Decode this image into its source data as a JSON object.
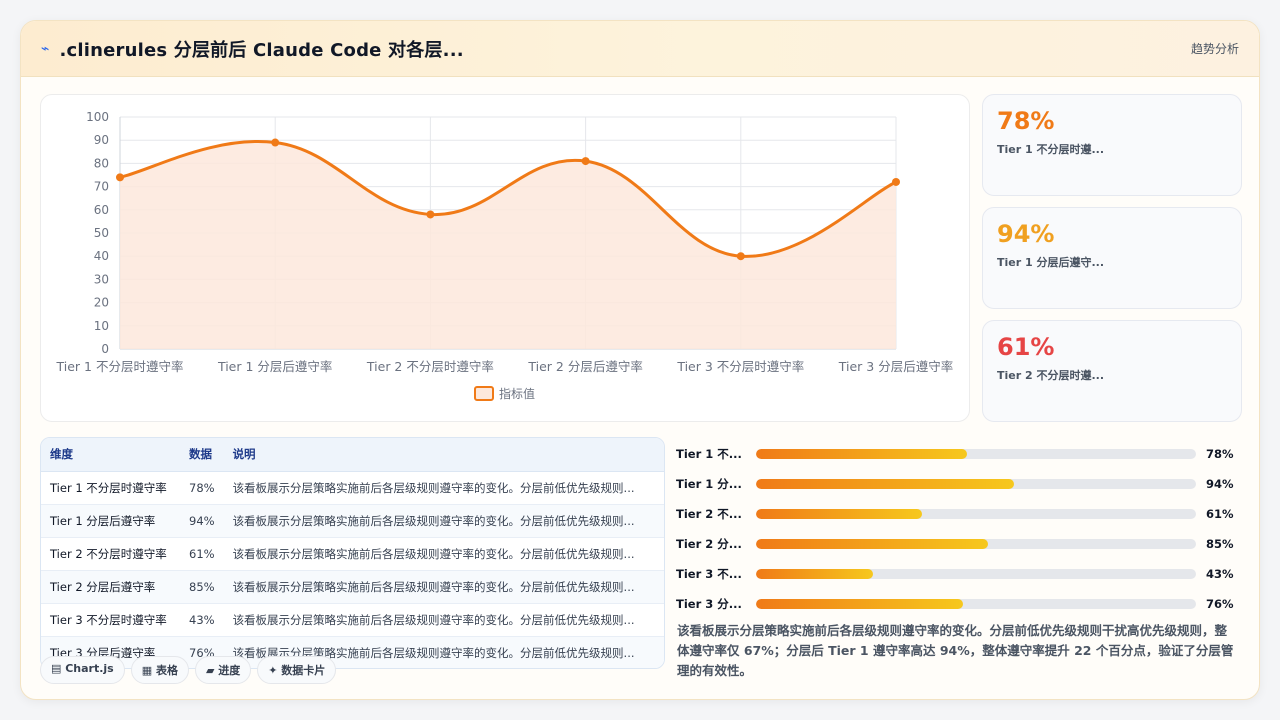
{
  "header": {
    "logo_icon": "trend-line-icon",
    "title": ".clinerules 分层前后 Claude Code 对各层...",
    "right_link": "趋势分析"
  },
  "chart_data": {
    "type": "line",
    "categories": [
      "Tier 1 不分层时遵守率",
      "Tier 1 分层后遵守率",
      "Tier 2 不分层时遵守率",
      "Tier 2 分层后遵守率",
      "Tier 3 不分层时遵守率",
      "Tier 3 分层后遵守率"
    ],
    "series": [
      {
        "name": "指标值",
        "values": [
          74,
          89,
          58,
          81,
          40,
          72
        ],
        "color": "#f07a17",
        "fill": "#fde8dc"
      }
    ],
    "yticks": [
      0,
      10,
      20,
      30,
      40,
      50,
      60,
      70,
      80,
      90,
      100
    ],
    "ylim": [
      0,
      100
    ],
    "smooth": true,
    "grid": true,
    "legend_position": "bottom"
  },
  "stats": [
    {
      "value": "78%",
      "label": "Tier 1 不分层时遵...",
      "color": "#f07a17"
    },
    {
      "value": "94%",
      "label": "Tier 1 分层后遵守...",
      "color": "#f0a020"
    },
    {
      "value": "61%",
      "label": "Tier 2 不分层时遵...",
      "color": "#e64545"
    }
  ],
  "table": {
    "headers": [
      "维度",
      "数据",
      "说明"
    ],
    "rows": [
      [
        "Tier 1 不分层时遵守率",
        "78%",
        "该看板展示分层策略实施前后各层级规则遵守率的变化。分层前低优先级规则..."
      ],
      [
        "Tier 1 分层后遵守率",
        "94%",
        "该看板展示分层策略实施前后各层级规则遵守率的变化。分层前低优先级规则..."
      ],
      [
        "Tier 2 不分层时遵守率",
        "61%",
        "该看板展示分层策略实施前后各层级规则遵守率的变化。分层前低优先级规则..."
      ],
      [
        "Tier 2 分层后遵守率",
        "85%",
        "该看板展示分层策略实施前后各层级规则遵守率的变化。分层前低优先级规则..."
      ],
      [
        "Tier 3 不分层时遵守率",
        "43%",
        "该看板展示分层策略实施前后各层级规则遵守率的变化。分层前低优先级规则..."
      ],
      [
        "Tier 3 分层后遵守率",
        "76%",
        "该看板展示分层策略实施前后各层级规则遵守率的变化。分层前低优先级规则..."
      ]
    ]
  },
  "tags": [
    "▤ Chart.js",
    "▦ 表格",
    "▰ 进度",
    "✦ 数据卡片"
  ],
  "progress": [
    {
      "label": "Tier 1 不...",
      "value_text": "78%",
      "value": 0.78,
      "fill_fraction": 0.48
    },
    {
      "label": "Tier 1 分...",
      "value_text": "94%",
      "value": 0.94,
      "fill_fraction": 0.586
    },
    {
      "label": "Tier 2 不...",
      "value_text": "61%",
      "value": 0.61,
      "fill_fraction": 0.377
    },
    {
      "label": "Tier 2 分...",
      "value_text": "85%",
      "value": 0.85,
      "fill_fraction": 0.527
    },
    {
      "label": "Tier 3 不...",
      "value_text": "43%",
      "value": 0.43,
      "fill_fraction": 0.266
    },
    {
      "label": "Tier 3 分...",
      "value_text": "76%",
      "value": 0.76,
      "fill_fraction": 0.47
    }
  ],
  "summary": "该看板展示分层策略实施前后各层级规则遵守率的变化。分层前低优先级规则干扰高优先级规则，整体遵守率仅 67%；分层后 Tier 1 遵守率高达 94%，整体遵守率提升 22 个百分点，验证了分层管理的有效性。"
}
